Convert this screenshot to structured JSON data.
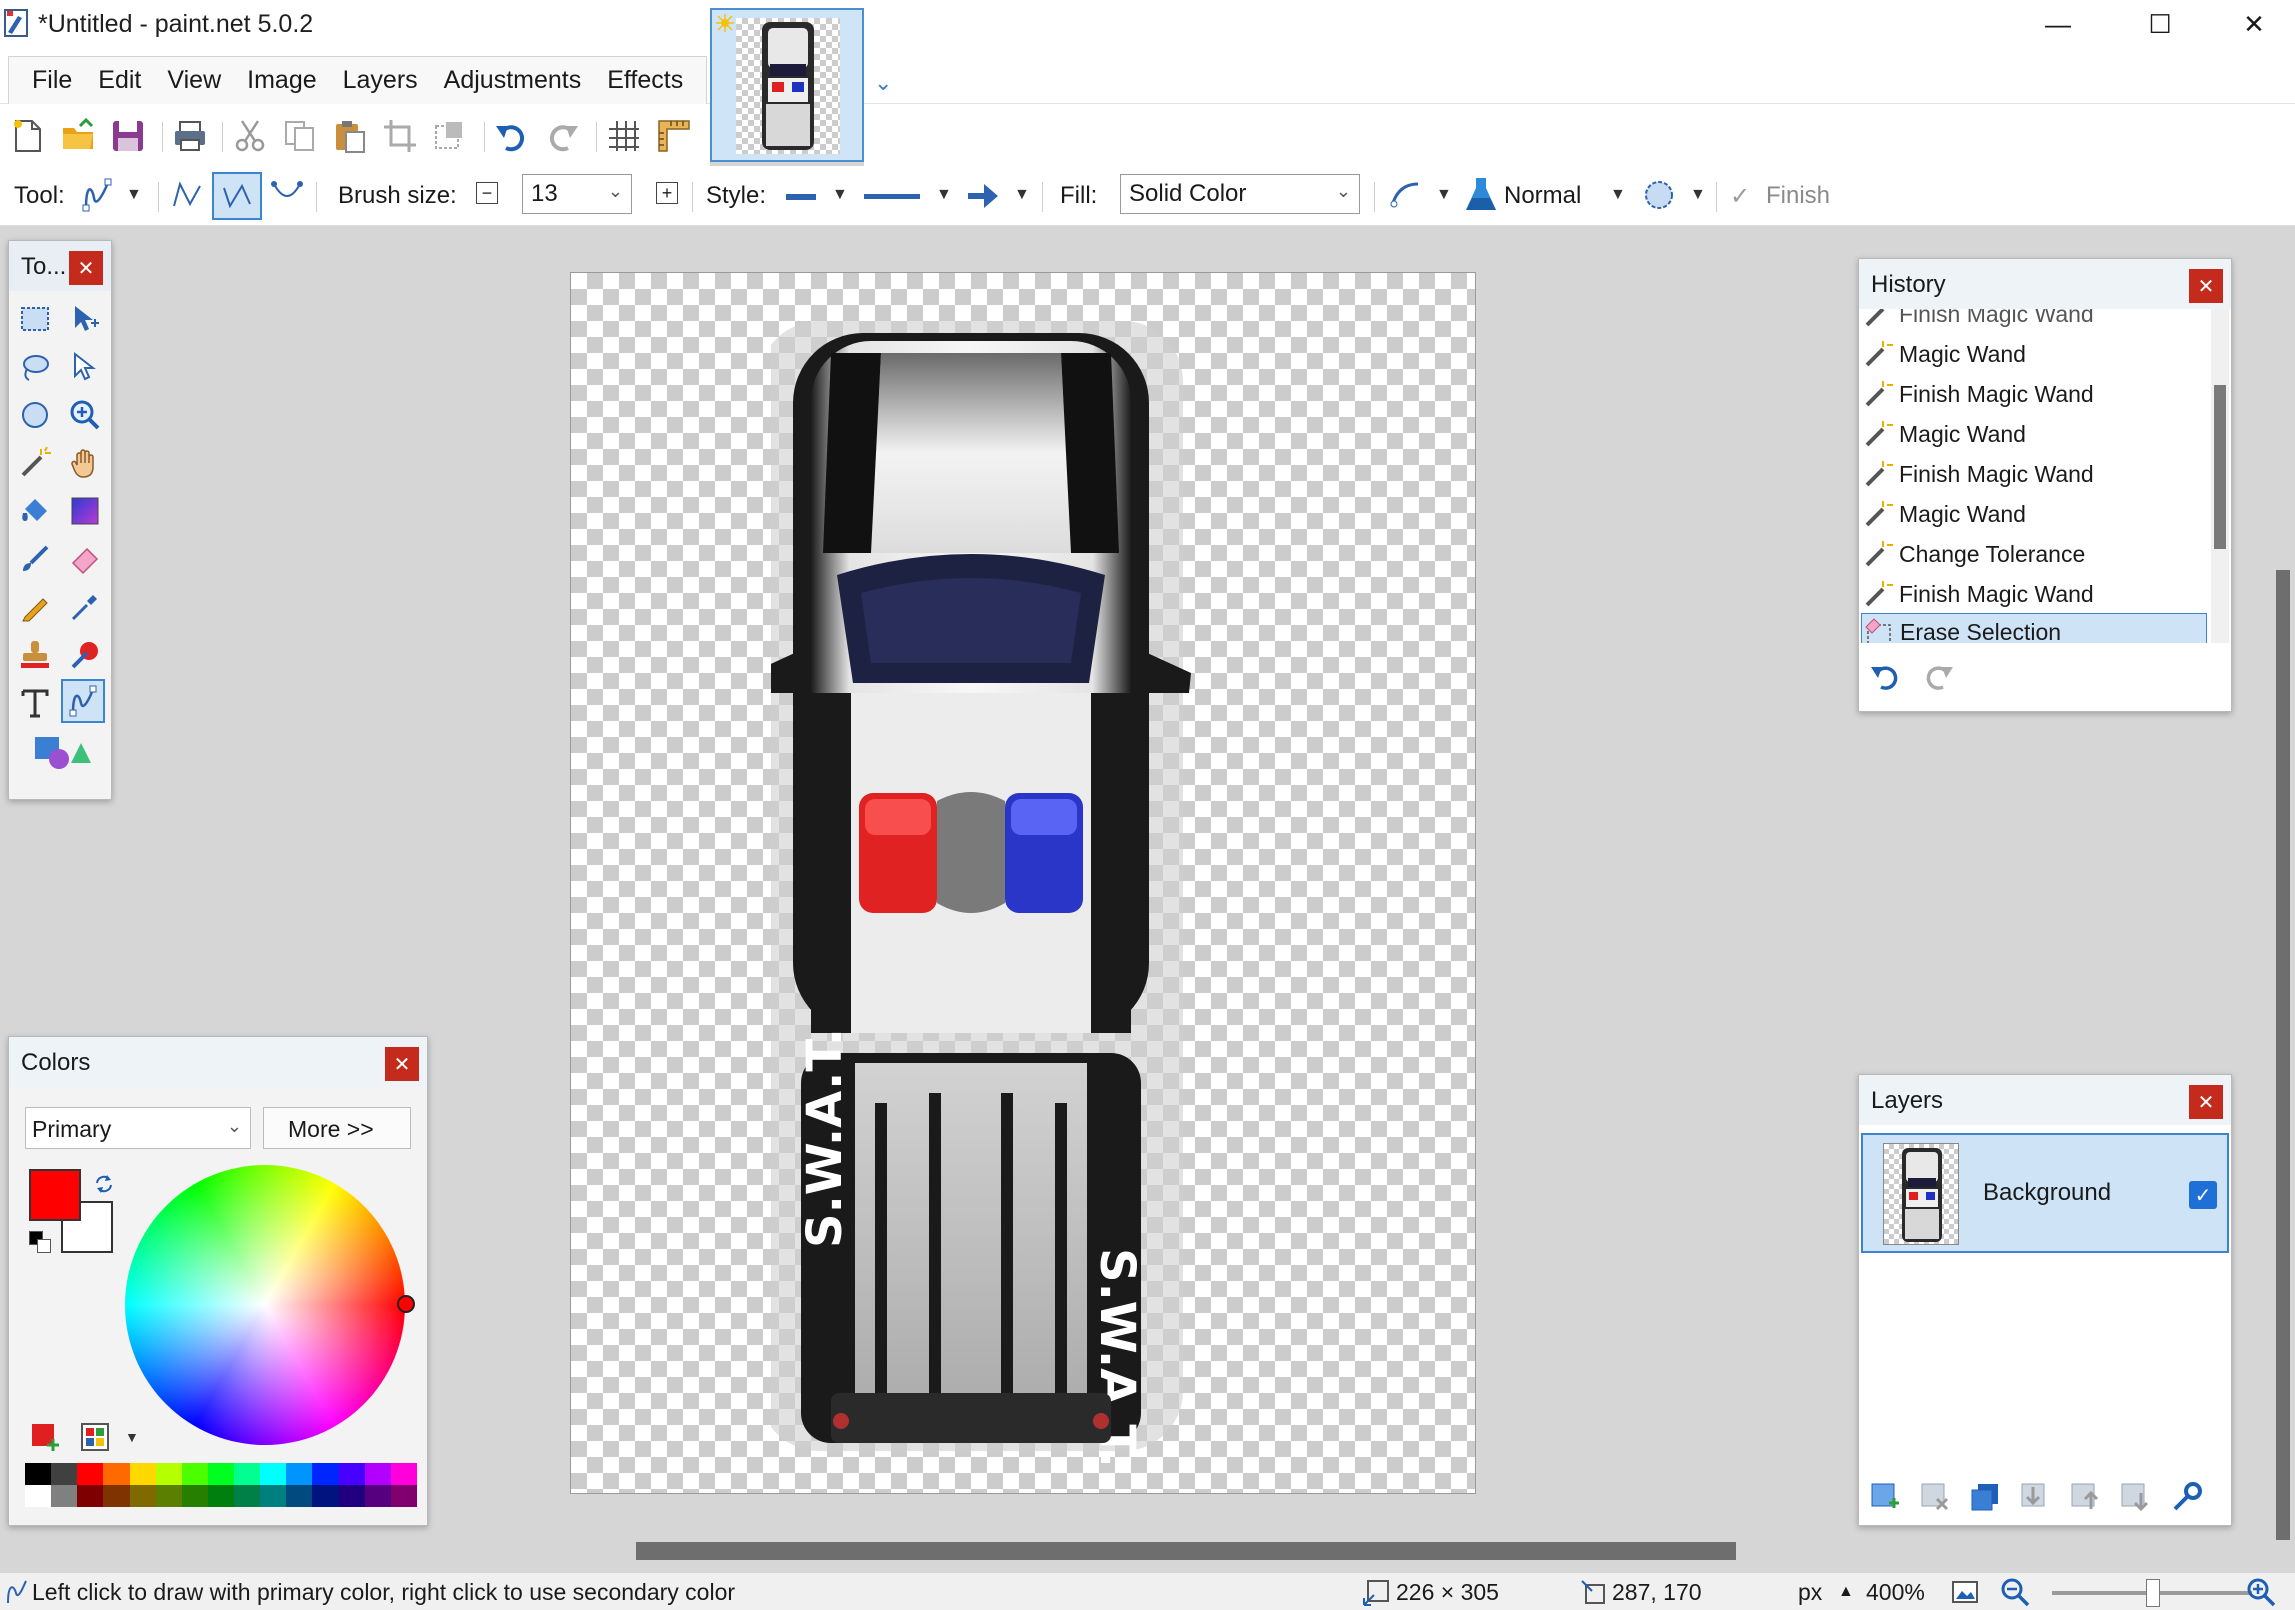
{
  "window": {
    "title": "*Untitled - paint.net 5.0.2",
    "minimize": "—",
    "maximize": "☐",
    "close": "✕"
  },
  "menu": {
    "items": [
      "File",
      "Edit",
      "View",
      "Image",
      "Layers",
      "Adjustments",
      "Effects"
    ],
    "hotkeys": [
      "F",
      "E",
      "V",
      "I",
      "L",
      "A",
      "c"
    ]
  },
  "toolbar": {
    "tool_label": "Tool:",
    "brush_size_label": "Brush size:",
    "brush_size_value": "13",
    "style_label": "Style:",
    "fill_label": "Fill:",
    "fill_value": "Solid Color",
    "blend_value": "Normal",
    "finish_label": "Finish"
  },
  "tools_panel": {
    "title": "To...",
    "close": "✕",
    "selected_tool": "line-curve-tool"
  },
  "history": {
    "title": "History",
    "close": "✕",
    "partial_item": "Finish Magic Wand",
    "items": [
      "Magic Wand",
      "Finish Magic Wand",
      "Magic Wand",
      "Finish Magic Wand",
      "Magic Wand",
      "Change Tolerance",
      "Finish Magic Wand",
      "Erase Selection"
    ],
    "current": "Erase Selection"
  },
  "layers": {
    "title": "Layers",
    "close": "✕",
    "items": [
      {
        "name": "Background",
        "visible": true,
        "selected": true
      }
    ]
  },
  "colors": {
    "title": "Colors",
    "close": "✕",
    "mode": "Primary",
    "more_label": "More >>",
    "primary": "#ff0000",
    "secondary": "#ffffff",
    "palette_top": [
      "#000000",
      "#404040",
      "#ff0000",
      "#ff6a00",
      "#ffd800",
      "#b6ff00",
      "#4cff00",
      "#00ff21",
      "#00ff90",
      "#00ffff",
      "#0094ff",
      "#0026ff",
      "#4800ff",
      "#b200ff",
      "#ff00dc"
    ],
    "palette_bottom": [
      "#ffffff",
      "#808080",
      "#7f0000",
      "#7f3300",
      "#7f6a00",
      "#5b7f00",
      "#267f00",
      "#007f0e",
      "#007f46",
      "#007f7f",
      "#004a7f",
      "#00137f",
      "#21007f",
      "#57007f",
      "#7f006e"
    ]
  },
  "canvas": {
    "decal_text": "S.W.A.T."
  },
  "status": {
    "hint": "Left click to draw with primary color, right click to use secondary color",
    "image_size": "226 × 305",
    "cursor_pos": "287, 170",
    "units": "px",
    "zoom": "400%"
  }
}
